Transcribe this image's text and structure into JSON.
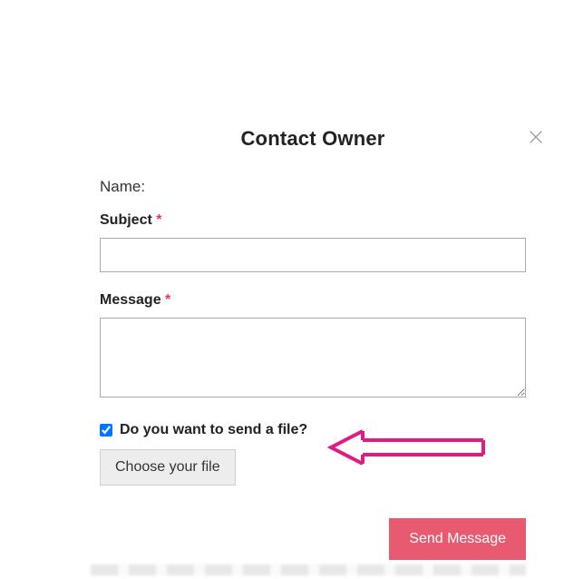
{
  "modal": {
    "title": "Contact Owner",
    "name_label": "Name:",
    "subject_label": "Subject",
    "required_mark": "*",
    "message_label": "Message",
    "send_file_label": "Do you want to send a file?",
    "send_file_checked": true,
    "choose_file_label": "Choose your file",
    "send_button_label": "Send Message"
  },
  "colors": {
    "accent": "#e85a6f",
    "required": "#e53960",
    "arrow": "#e01b84"
  }
}
